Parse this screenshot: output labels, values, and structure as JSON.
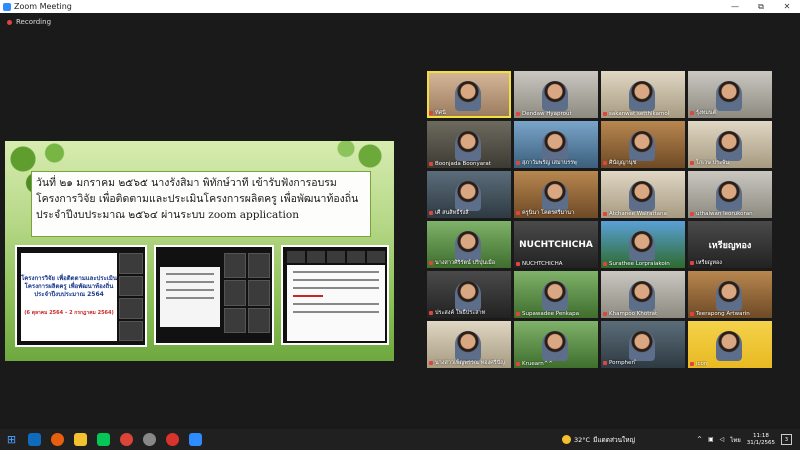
{
  "window": {
    "title": "Zoom Meeting",
    "minimize": "—",
    "maximize": "⧉",
    "close": "✕"
  },
  "recording": {
    "label": "Recording"
  },
  "share": {
    "header_text": "วันที่ ๒๑ มกราคม ๒๕๖๕ นางรังสิมา  พิทักษ์วาที เข้ารับฟังการอบรมโครงการวิจัย เพื่อติดตามและประเมินโครงการผลิตครู เพื่อพัฒนาท้องถิ่น ประจำปีงบประมาณ ๒๕๖๔ ผ่านระบบ zoom application",
    "slide1_title": "โครงการวิจัย เพื่อติดตามและประเมินโครงการผลิตครู เพื่อพัฒนาท้องถิ่น ประจำปีงบประมาณ 2564",
    "slide1_dates": "(6 ตุลาคม 2564 – 2 กรกฎาคม 2564)"
  },
  "participants": [
    {
      "name": "ทัศนี",
      "active": true,
      "bg": "bg9"
    },
    {
      "name": "Dendaw Hyaprout",
      "bg": "bg2"
    },
    {
      "name": "sakanwat setthikamol",
      "bg": "bg6"
    },
    {
      "name": "รุ้งทมนต์",
      "bg": "bg2"
    },
    {
      "name": "Boonjada Boonyarat",
      "bg": "bg1"
    },
    {
      "name": "สุภาวัมพรัญ เสมาบรรพุ",
      "bg": "bg5"
    },
    {
      "name": "ศินัญญานุช",
      "bg": "bg4"
    },
    {
      "name": "โกเวษ ประจัน",
      "bg": "bg6"
    },
    {
      "name": "เศี สนสิทธิ์รังสี",
      "bg": "bg3"
    },
    {
      "name": "ครูนินา  โคตรศรีมานา",
      "bg": "bg4"
    },
    {
      "name": "Atchanee Wairattana",
      "bg": "bg6"
    },
    {
      "name": "uthaiwan leorukoran",
      "bg": "bg2"
    },
    {
      "name": "นางสาวศิริรัตน์ ปริปุ่นเมือ",
      "bg": "bg8"
    },
    {
      "name": "NUCHTCHICHA",
      "big": "NUCHTCHICHA",
      "bg": "bg7"
    },
    {
      "name": "Surathee  Lorpraiakoin",
      "bg": "bgW"
    },
    {
      "name": "เหรียญทอง",
      "big": "เหรียญทอง",
      "bg": "bg7"
    },
    {
      "name": "ประสงค์ โพธิ์ประสาท",
      "bg": "bg7"
    },
    {
      "name": "Supawadee Penkapa",
      "bg": "bg8"
    },
    {
      "name": "Khampoo Khotrat",
      "bg": "bg2"
    },
    {
      "name": "Teerapong Artwarin",
      "bg": "bg4"
    },
    {
      "name": "นางสาวเพ็ญพรรณ  ทองศรีปัญ",
      "bg": "bg6"
    },
    {
      "name": "Kruearn^^",
      "bg": "bg8"
    },
    {
      "name": "Pornphen ิ",
      "bg": "bg3"
    },
    {
      "name": "icon",
      "bg": "bgY"
    }
  ],
  "taskbar": {
    "weather_temp": "32°C",
    "weather_text": "มีแดดส่วนใหญ่",
    "lang": "ไทย",
    "time": "11:18",
    "date": "31/1/2565",
    "notif_count": "3"
  }
}
